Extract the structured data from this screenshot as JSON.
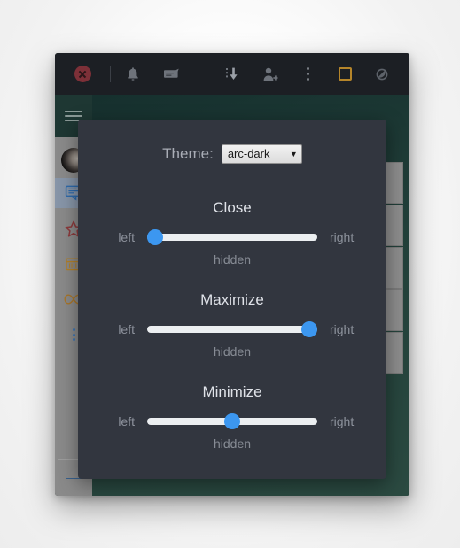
{
  "window": {
    "toolbar": {
      "left_buttons": [
        {
          "name": "close-icon",
          "label": "Close"
        }
      ],
      "right_buttons": [
        {
          "name": "sort-descending-icon",
          "label": "Sort descending"
        },
        {
          "name": "add-person-icon",
          "label": "Add person"
        },
        {
          "name": "overflow-menu-icon",
          "label": "More options"
        },
        {
          "name": "stop-recording-icon",
          "label": "Stop"
        },
        {
          "name": "mute-icon",
          "label": "Mute"
        }
      ],
      "middle_buttons": [
        {
          "name": "bell-icon",
          "label": "Notifications"
        },
        {
          "name": "comment-icon",
          "label": "Comments"
        }
      ]
    },
    "sidebar": {
      "menu_icon": "hamburger-icon",
      "avatar": "user-avatar",
      "items": [
        {
          "name": "sidebar-item-messages",
          "icon": "message-icon",
          "active": true
        },
        {
          "name": "sidebar-item-favorites",
          "icon": "star-icon",
          "active": false
        },
        {
          "name": "sidebar-item-calendar",
          "icon": "calendar-icon",
          "active": false
        },
        {
          "name": "sidebar-item-links",
          "icon": "infinity-icon",
          "active": false
        },
        {
          "name": "sidebar-item-more",
          "icon": "vertical-dots-icon",
          "active": false
        }
      ],
      "add_button": {
        "name": "add-button",
        "icon": "plus-icon"
      }
    },
    "list_panel": {
      "items": [
        {
          "name": "list-item"
        },
        {
          "name": "list-item"
        },
        {
          "name": "list-item"
        },
        {
          "name": "list-item"
        },
        {
          "name": "list-item"
        }
      ]
    }
  },
  "dialog": {
    "theme": {
      "label": "Theme:",
      "selected": "arc-dark",
      "caret": "▼",
      "options": [
        "arc-dark"
      ]
    },
    "sliders": [
      {
        "title": "Close",
        "left_label": "left",
        "right_label": "right",
        "sub_label": "hidden",
        "value": 0,
        "min": 0,
        "max": 100
      },
      {
        "title": "Maximize",
        "left_label": "left",
        "right_label": "right",
        "sub_label": "hidden",
        "value": 100,
        "min": 0,
        "max": 100
      },
      {
        "title": "Minimize",
        "left_label": "left",
        "right_label": "right",
        "sub_label": "hidden",
        "value": 50,
        "min": 0,
        "max": 100
      }
    ]
  },
  "colors": {
    "dialog_bg": "#32363f",
    "toolbar_bg": "#1c1f24",
    "content_bg": "#223c38",
    "accent_blue": "#3c97f0",
    "track": "#eceff1",
    "close_red": "#7d3038",
    "orange_outline": "#b5852a",
    "sidebar_bg": "#8a8a8a"
  }
}
